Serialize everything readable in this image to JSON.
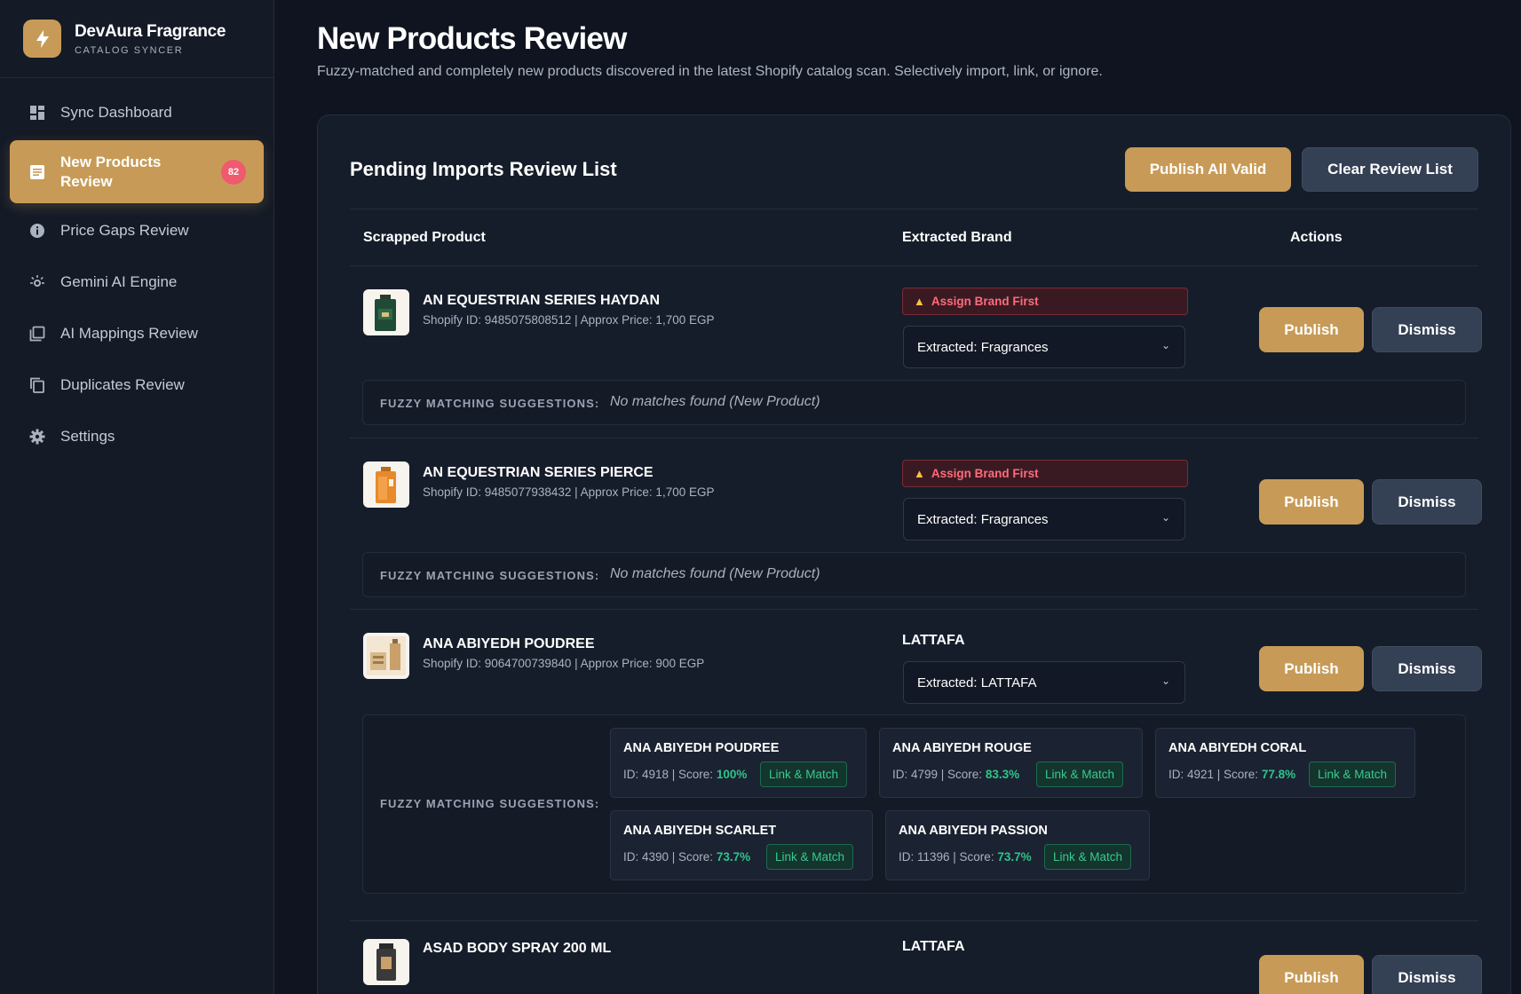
{
  "app": {
    "name": "DevAura Fragrance",
    "subtitle": "CATALOG SYNCER",
    "logo_icon": "lightning-icon"
  },
  "sidebar": {
    "items": [
      {
        "label": "Sync Dashboard",
        "icon": "grid-icon"
      },
      {
        "label": "New Products Review",
        "icon": "list-icon",
        "badge": "82",
        "active": true
      },
      {
        "label": "Price Gaps Review",
        "icon": "info-icon"
      },
      {
        "label": "Gemini AI Engine",
        "icon": "sparkle-icon"
      },
      {
        "label": "AI Mappings Review",
        "icon": "layers-icon"
      },
      {
        "label": "Duplicates Review",
        "icon": "copy-icon"
      },
      {
        "label": "Settings",
        "icon": "gear-icon"
      }
    ]
  },
  "page": {
    "title": "New Products Review",
    "subtitle": "Fuzzy-matched and completely new products discovered in the latest Shopify catalog scan. Selectively import, link, or ignore."
  },
  "review": {
    "title": "Pending Imports Review List",
    "publish_all": "Publish All Valid",
    "clear": "Clear Review List",
    "columns": [
      "Scrapped Product",
      "Extracted Brand",
      "Actions"
    ],
    "fuzzy_label": "FUZZY MATCHING SUGGESTIONS:",
    "publish_label": "Publish",
    "dismiss_label": "Dismiss",
    "link_label": "Link & Match",
    "rows": [
      {
        "name": "AN EQUESTRIAN SERIES HAYDAN",
        "meta": "Shopify ID: 9485075808512 | Approx Price: 1,700 EGP",
        "warning": "Assign Brand First",
        "select": "Extracted: Fragrances",
        "no_matches": "No matches found (New Product)"
      },
      {
        "name": "AN EQUESTRIAN SERIES PIERCE",
        "meta": "Shopify ID: 9485077938432 | Approx Price: 1,700 EGP",
        "warning": "Assign Brand First",
        "select": "Extracted: Fragrances",
        "no_matches": "No matches found (New Product)"
      },
      {
        "name": "ANA ABIYEDH POUDREE",
        "meta": "Shopify ID: 9064700739840 | Approx Price: 900 EGP",
        "brand": "LATTAFA",
        "select": "Extracted: LATTAFA",
        "suggestions": [
          {
            "name": "ANA ABIYEDH POUDREE",
            "id": "ID: 4918 | Score: ",
            "score": "100%"
          },
          {
            "name": "ANA ABIYEDH ROUGE",
            "id": "ID: 4799 | Score: ",
            "score": "83.3%"
          },
          {
            "name": "ANA ABIYEDH CORAL",
            "id": "ID: 4921 | Score: ",
            "score": "77.8%"
          },
          {
            "name": "ANA ABIYEDH SCARLET",
            "id": "ID: 4390 | Score: ",
            "score": "73.7%"
          },
          {
            "name": "ANA ABIYEDH PASSION",
            "id": "ID: 11396 | Score: ",
            "score": "73.7%"
          }
        ]
      },
      {
        "name": "ASAD BODY SPRAY 200 ML",
        "brand": "LATTAFA"
      }
    ]
  },
  "colors": {
    "accent": "#c79b57",
    "background": "#0f1420",
    "badge": "#ef5a6f",
    "score": "#2ec48a",
    "warning": "#ff6b7b"
  }
}
